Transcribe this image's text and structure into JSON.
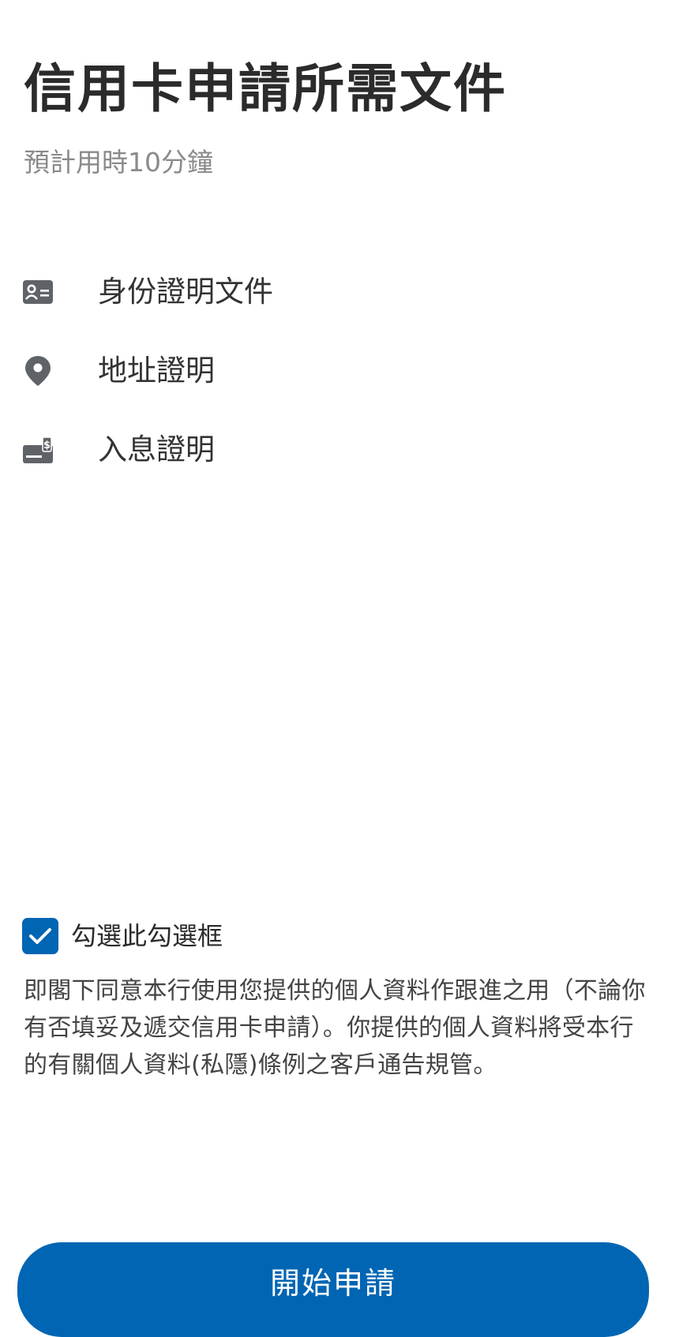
{
  "header": {
    "title": "信用卡申請所需文件",
    "subtitle": "預計用時10分鐘"
  },
  "documents": [
    {
      "icon": "id-card-icon",
      "label": "身份證明文件"
    },
    {
      "icon": "location-pin-icon",
      "label": "地址證明"
    },
    {
      "icon": "income-cash-icon",
      "label": "入息證明"
    }
  ],
  "consent": {
    "checkbox_label": "勾選此勾選框",
    "checked": true,
    "text": "即閣下同意本行使用您提供的個人資料作跟進之用（不論你有否填妥及遞交信用卡申請）。你提供的個人資料將受本行的有關個人資料(私隱)條例之客戶通告規管。"
  },
  "actions": {
    "start_label": "開始申請"
  },
  "colors": {
    "primary": "#0065b3",
    "icon": "#5f6368",
    "title": "#2b2b2b",
    "subtitle": "#8a8a8a"
  }
}
